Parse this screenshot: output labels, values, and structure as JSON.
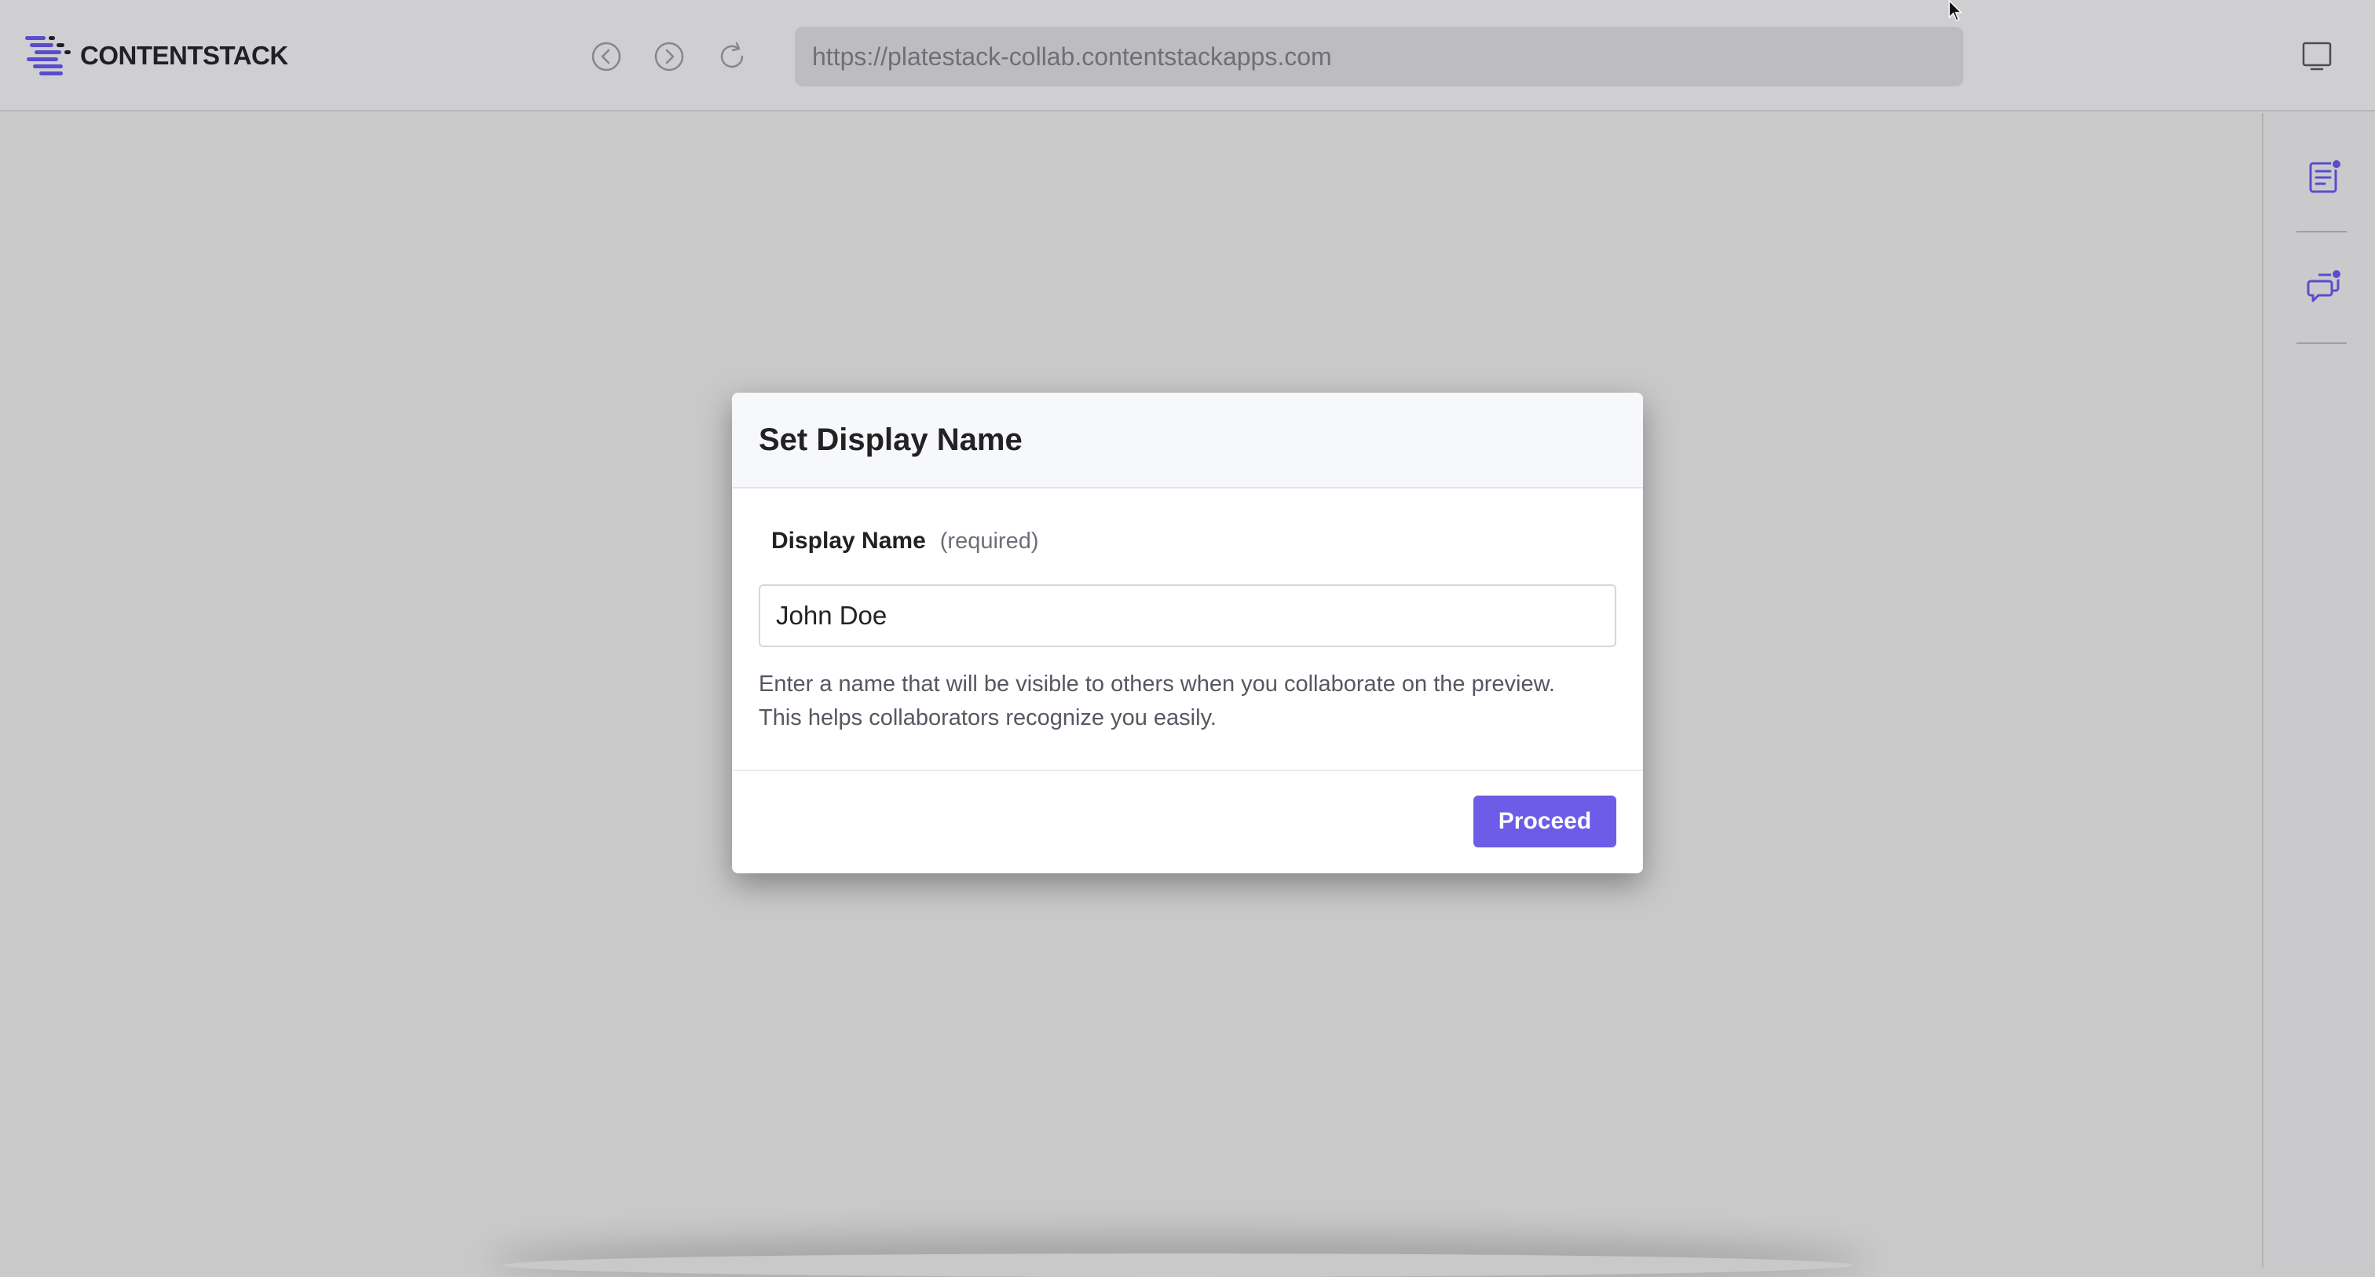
{
  "app": {
    "brand_name": "CONTENTSTACK",
    "url": "https://platestack-collab.contentstackapps.com"
  },
  "colors": {
    "accent": "#6c5ce7",
    "notification_dot": "#5b4ccc"
  },
  "icons": {
    "logo": "contentstack-logo-icon",
    "back": "back-arrow-icon",
    "forward": "forward-arrow-icon",
    "reload": "reload-icon",
    "monitor": "monitor-icon",
    "notes": "notes-icon",
    "comments": "comments-icon"
  },
  "modal": {
    "title": "Set Display Name",
    "field_label": "Display Name",
    "field_required": "(required)",
    "input_value": "John Doe",
    "help_line_1": "Enter a name that will be visible to others when you collaborate on the preview.",
    "help_line_2": "This helps collaborators recognize you easily.",
    "proceed_label": "Proceed"
  }
}
